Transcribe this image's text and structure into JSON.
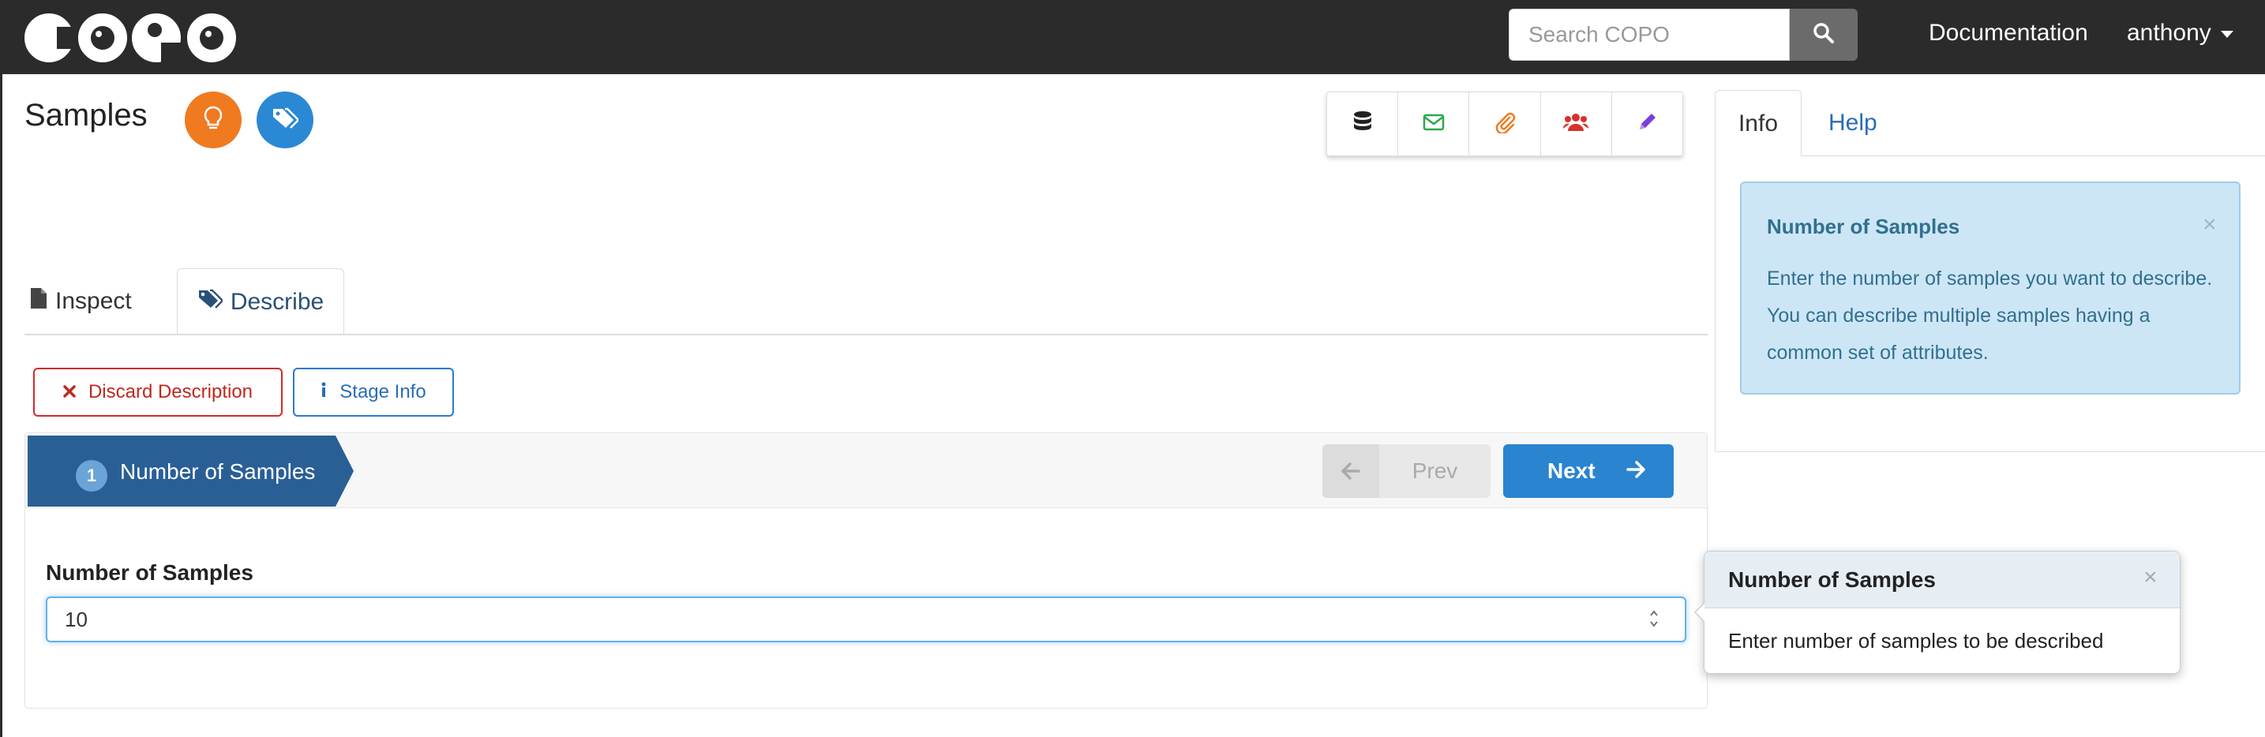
{
  "navbar": {
    "logo_text": "COPO",
    "search_placeholder": "Search COPO",
    "docs_label": "Documentation",
    "user_label": "anthony"
  },
  "page": {
    "title": "Samples"
  },
  "right_panel": {
    "tabs": [
      "Info",
      "Help"
    ],
    "info_title": "Number of Samples",
    "info_text": "Enter the number of samples you want to describe. You can describe multiple samples having a common set of attributes.",
    "close_glyph": "×"
  },
  "main_tabs": {
    "inspect": "Inspect",
    "describe": "Describe"
  },
  "actions": {
    "discard_label": "Discard Description",
    "stage_info_label": "Stage Info"
  },
  "wizard": {
    "step_number": "1",
    "step_label": "Number of Samples",
    "prev_label": "Prev",
    "next_label": "Next",
    "field_label": "Number of Samples",
    "field_value": "10"
  },
  "popover": {
    "title": "Number of Samples",
    "text": "Enter number of samples to be described",
    "close_glyph": "×"
  },
  "colors": {
    "navbar_bg": "#2b2b2b",
    "accent_orange": "#f07a20",
    "accent_blue": "#2b88d4",
    "step_bg": "#2a5f96",
    "discard_red": "#d42a2a",
    "info_bg": "#cde6f5"
  },
  "icons": {
    "toolbar": [
      "database-icon",
      "envelope-icon",
      "paperclip-icon",
      "users-icon",
      "pencil-icon"
    ]
  }
}
